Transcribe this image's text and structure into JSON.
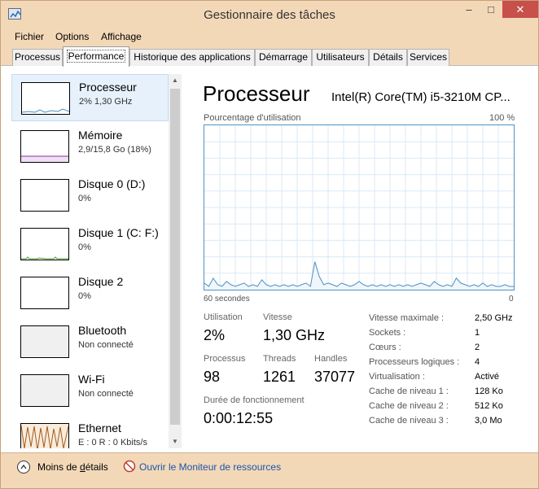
{
  "window": {
    "title": "Gestionnaire des tâches",
    "controls": {
      "minimize": "–",
      "maximize": "□",
      "close": "✕"
    }
  },
  "menu": [
    "Fichier",
    "Options",
    "Affichage"
  ],
  "tabs": [
    {
      "label": "Processus",
      "active": false
    },
    {
      "label": "Performance",
      "active": true
    },
    {
      "label": "Historique des applications",
      "active": false
    },
    {
      "label": "Démarrage",
      "active": false
    },
    {
      "label": "Utilisateurs",
      "active": false
    },
    {
      "label": "Détails",
      "active": false
    },
    {
      "label": "Services",
      "active": false
    }
  ],
  "sidebar": {
    "items": [
      {
        "title": "Processeur",
        "subtitle": "2% 1,30 GHz",
        "color": "#4a90c2",
        "selected": true
      },
      {
        "title": "Mémoire",
        "subtitle": "2,9/15,8 Go (18%)",
        "color": "#8b2fa6",
        "selected": false
      },
      {
        "title": "Disque 0 (D:)",
        "subtitle": "0%",
        "color": "#4aa02c",
        "selected": false
      },
      {
        "title": "Disque 1 (C: F:)",
        "subtitle": "0%",
        "color": "#4aa02c",
        "selected": false
      },
      {
        "title": "Disque 2",
        "subtitle": "0%",
        "color": "#4aa02c",
        "selected": false
      },
      {
        "title": "Bluetooth",
        "subtitle": "Non connecté",
        "color": "#c8c8c8",
        "selected": false
      },
      {
        "title": "Wi-Fi",
        "subtitle": "Non connecté",
        "color": "#c8c8c8",
        "selected": false
      },
      {
        "title": "Ethernet",
        "subtitle": "E : 0 R : 0 Kbits/s",
        "color": "#a65c1a",
        "selected": false
      }
    ]
  },
  "main": {
    "title": "Processeur",
    "cpu_name": "Intel(R) Core(TM) i5-3210M CP...",
    "graph_label": "Pourcentage d'utilisation",
    "graph_max": "100 %",
    "axis_left": "60 secondes",
    "axis_right": "0",
    "usage_series": [
      4,
      2,
      7,
      3,
      2,
      5,
      3,
      2,
      3,
      4,
      2,
      3,
      2,
      6,
      3,
      2,
      3,
      2,
      3,
      2,
      3,
      2,
      3,
      4,
      2,
      17,
      8,
      3,
      4,
      3,
      2,
      4,
      3,
      2,
      3,
      5,
      3,
      2,
      3,
      2,
      3,
      2,
      3,
      2,
      3,
      2,
      3,
      2,
      3,
      4,
      3,
      2,
      5,
      3,
      2,
      3,
      2,
      7,
      4,
      3,
      2,
      3,
      2,
      4,
      2,
      3,
      2,
      2,
      3,
      2,
      2
    ]
  },
  "stats": {
    "utilisation_label": "Utilisation",
    "utilisation_value": "2%",
    "vitesse_label": "Vitesse",
    "vitesse_value": "1,30 GHz",
    "processus_label": "Processus",
    "processus_value": "98",
    "threads_label": "Threads",
    "threads_value": "1261",
    "handles_label": "Handles",
    "handles_value": "37077",
    "uptime_label": "Durée de fonctionnement",
    "uptime_value": "0:00:12:55"
  },
  "specs": [
    {
      "label": "Vitesse maximale :",
      "value": "2,50 GHz"
    },
    {
      "label": "Sockets :",
      "value": "1"
    },
    {
      "label": "Cœurs :",
      "value": "2"
    },
    {
      "label": "Processeurs logiques :",
      "value": "4"
    },
    {
      "label": "Virtualisation :",
      "value": "Activé"
    },
    {
      "label": "Cache de niveau 1 :",
      "value": "128 Ko"
    },
    {
      "label": "Cache de niveau 2 :",
      "value": "512 Ko"
    },
    {
      "label": "Cache de niveau 3 :",
      "value": "3,0 Mo"
    }
  ],
  "footer": {
    "less_details_prefix": "Moins de ",
    "less_details_underlined": "d",
    "less_details_suffix": "étails",
    "resource_monitor": "Ouvrir le Moniteur de ressources"
  }
}
